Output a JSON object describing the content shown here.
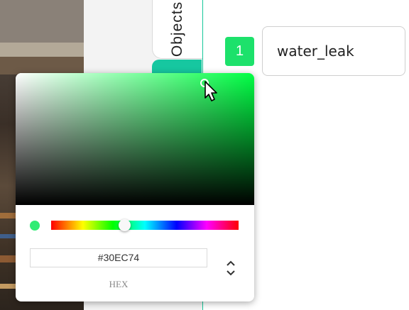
{
  "objects_tab": {
    "label": "Objects"
  },
  "label_row": {
    "index": "1",
    "name": "water_leak"
  },
  "color_picker": {
    "hex_value": "#30EC74",
    "mode_label": "HEX",
    "selected_color": "#30ec74",
    "hue_color": "#00ff44"
  },
  "colors": {
    "accent": "#16c7a0",
    "badge": "#1de16b"
  },
  "icons": {
    "mode_toggle": "chevron-up-down-icon",
    "cursor": "mouse-pointer-icon"
  }
}
